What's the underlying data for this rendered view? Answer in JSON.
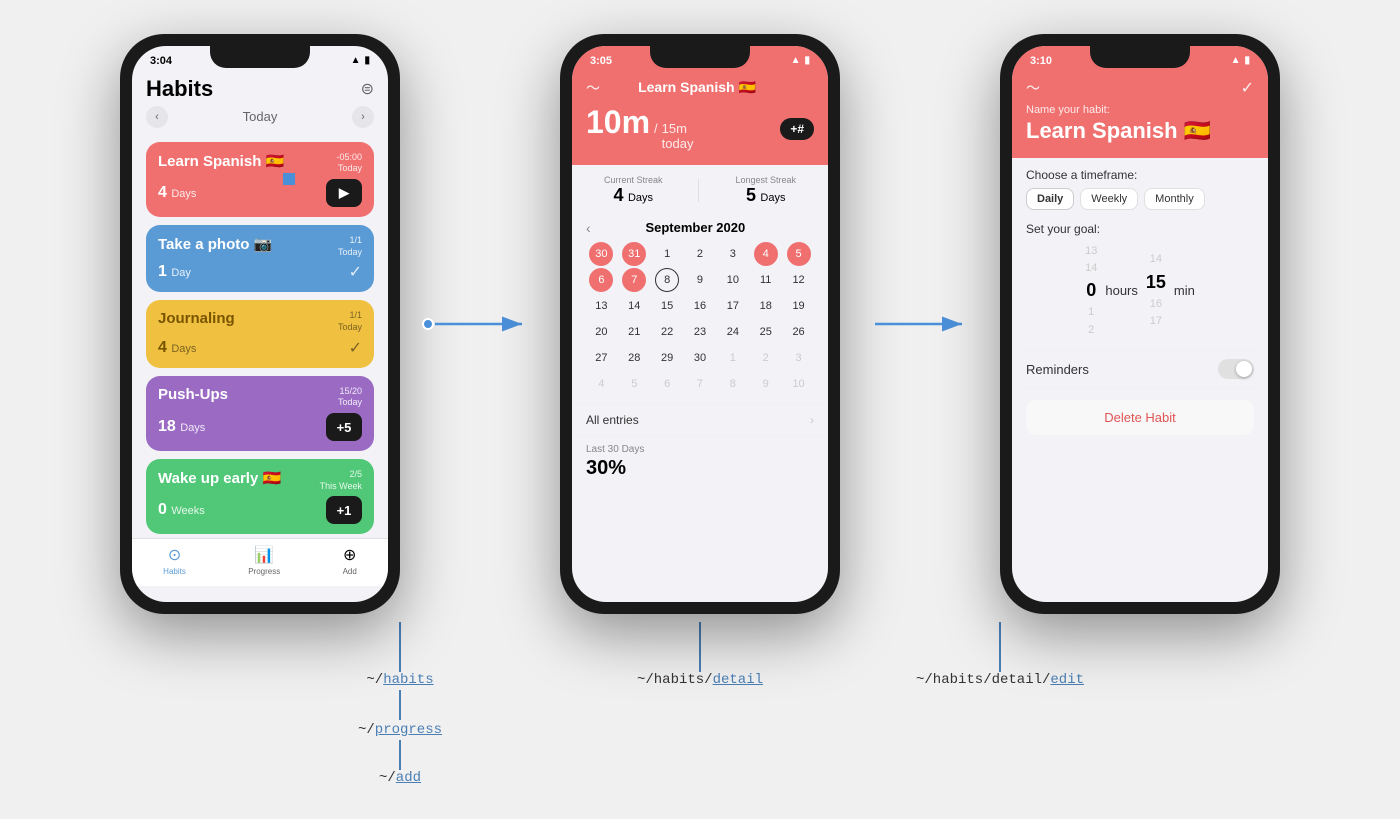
{
  "page": {
    "background": "#f0f0f0"
  },
  "phones": [
    {
      "id": "habits",
      "statusBar": {
        "time": "3:04",
        "signal": true,
        "wifi": true,
        "battery": true
      },
      "screen": "habits",
      "route": "~/habits",
      "routeUnderline": "habits"
    },
    {
      "id": "detail",
      "statusBar": {
        "time": "3:05",
        "signal": true,
        "wifi": true,
        "battery": true
      },
      "screen": "detail",
      "route": "~/habits/detail",
      "routeUnderline": "detail"
    },
    {
      "id": "edit",
      "statusBar": {
        "time": "3:10",
        "signal": true,
        "wifi": true,
        "battery": true
      },
      "screen": "edit",
      "route": "~/habits/detail/edit",
      "routeUnderline": "edit"
    }
  ],
  "habitsScreen": {
    "title": "Habits",
    "dateLabel": "Today",
    "settingsIcon": "≡",
    "habits": [
      {
        "name": "Learn Spanish 🇪🇸",
        "color": "red",
        "badge1": "-05:00",
        "badge2": "Today",
        "streak": "4",
        "streakUnit": "Days",
        "actionType": "play",
        "actionLabel": "▶"
      },
      {
        "name": "Take a photo 📷",
        "color": "blue",
        "badge1": "1/1",
        "badge2": "Today",
        "streak": "1",
        "streakUnit": "Day",
        "actionType": "check",
        "actionLabel": "✓"
      },
      {
        "name": "Journaling",
        "color": "yellow",
        "badge1": "1/1",
        "badge2": "Today",
        "streak": "4",
        "streakUnit": "Days",
        "actionType": "check",
        "actionLabel": "✓"
      },
      {
        "name": "Push-Ups",
        "color": "purple",
        "badge1": "15/20",
        "badge2": "Today",
        "streak": "18",
        "streakUnit": "Days",
        "actionType": "plus",
        "actionLabel": "+5"
      },
      {
        "name": "Wake up early 🇪🇸",
        "color": "green",
        "badge1": "2/5",
        "badge2": "This Week",
        "streak": "0",
        "streakUnit": "Weeks",
        "actionType": "plus",
        "actionLabel": "+1"
      }
    ],
    "tabs": [
      {
        "icon": "⊙",
        "label": "Habits",
        "active": true
      },
      {
        "icon": "📊",
        "label": "Progress",
        "active": false
      },
      {
        "icon": "⊕",
        "label": "Add",
        "active": false
      }
    ]
  },
  "detailScreen": {
    "title": "Learn Spanish 🇪🇸",
    "backIcon": "〜",
    "timeValue": "10m",
    "timeSeparator": "/",
    "timeGoal": "15m",
    "timeLabel": "today",
    "plusHashBtn": "+#",
    "currentStreakLabel": "Current Streak",
    "currentStreakValue": "4",
    "currentStreakUnit": "Days",
    "longestStreakLabel": "Longest Streak",
    "longestStreakValue": "5",
    "longestStreakUnit": "Days",
    "calendarMonth": "September 2020",
    "calendarDays": [
      {
        "day": "30",
        "otherMonth": true,
        "completed": true
      },
      {
        "day": "31",
        "otherMonth": true,
        "completed": true
      },
      {
        "day": "1",
        "completed": false
      },
      {
        "day": "2",
        "completed": false
      },
      {
        "day": "3",
        "completed": false
      },
      {
        "day": "4",
        "completed": true
      },
      {
        "day": "5",
        "completed": true
      },
      {
        "day": "6",
        "completed": true
      },
      {
        "day": "7",
        "completed": true
      },
      {
        "day": "8",
        "today": true,
        "completed": false
      },
      {
        "day": "9",
        "completed": false
      },
      {
        "day": "10",
        "completed": false
      },
      {
        "day": "11",
        "completed": false
      },
      {
        "day": "12",
        "completed": false
      },
      {
        "day": "13",
        "completed": false
      },
      {
        "day": "14",
        "completed": false
      },
      {
        "day": "15",
        "completed": false
      },
      {
        "day": "16",
        "completed": false
      },
      {
        "day": "17",
        "completed": false
      },
      {
        "day": "18",
        "completed": false
      },
      {
        "day": "19",
        "completed": false
      },
      {
        "day": "20",
        "completed": false
      },
      {
        "day": "21",
        "completed": false
      },
      {
        "day": "22",
        "completed": false
      },
      {
        "day": "23",
        "completed": false
      },
      {
        "day": "24",
        "completed": false
      },
      {
        "day": "25",
        "completed": false
      },
      {
        "day": "26",
        "completed": false
      },
      {
        "day": "27",
        "completed": false
      },
      {
        "day": "28",
        "completed": false
      },
      {
        "day": "29",
        "completed": false
      },
      {
        "day": "30",
        "completed": false
      },
      {
        "day": "1",
        "otherMonth": true
      },
      {
        "day": "2",
        "otherMonth": true
      },
      {
        "day": "3",
        "otherMonth": true
      },
      {
        "day": "4",
        "otherMonth": true
      },
      {
        "day": "5",
        "otherMonth": true
      },
      {
        "day": "6",
        "otherMonth": true
      },
      {
        "day": "7",
        "otherMonth": true
      },
      {
        "day": "8",
        "otherMonth": true
      },
      {
        "day": "9",
        "otherMonth": true
      },
      {
        "day": "10",
        "otherMonth": true
      }
    ],
    "allEntriesLabel": "All entries",
    "last30Label": "Last 30 Days",
    "last30Value": "30%"
  },
  "editScreen": {
    "backIcon": "〜",
    "checkIcon": "✓",
    "nameLabel": "Name your habit:",
    "nameValue": "Learn Spanish 🇪🇸",
    "timeframeLabel": "Choose a timeframe:",
    "timeframeOptions": [
      "Daily",
      "Weekly",
      "Monthly"
    ],
    "activeTimeframe": "Daily",
    "goalLabel": "Set your goal:",
    "hoursLabel": "hours",
    "minutesLabel": "min",
    "hoursValues": [
      "13",
      "14",
      "0",
      "1",
      "2"
    ],
    "minutesValues": [
      "14",
      "15",
      "16",
      "17"
    ],
    "selectedHours": "0",
    "selectedMinutes": "15",
    "remindersLabel": "Reminders",
    "deleteLabel": "Delete Habit"
  },
  "labels": {
    "phone1Routes": [
      "~/habits",
      "~/progress",
      "~/add"
    ],
    "phone2Route": "~/habits/detail",
    "phone3Route": "~/habits/detail/edit"
  }
}
